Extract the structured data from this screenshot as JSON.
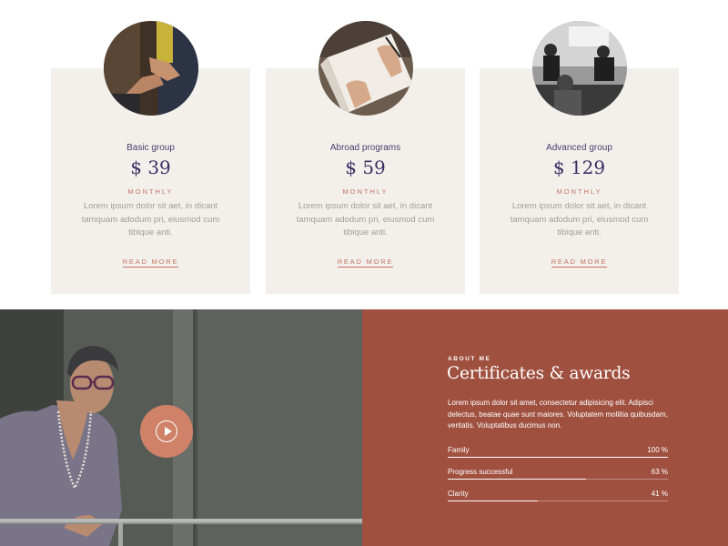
{
  "pricing": {
    "cards": [
      {
        "name": "Basic group",
        "price": "$ 39",
        "period": "MONTHLY",
        "text": "Lorem ipsum dolor sit aet, in dicant tamquam adodum pri, eiusmod cum tibique anti.",
        "link": "READ MORE"
      },
      {
        "name": "Abroad programs",
        "price": "$ 59",
        "period": "MONTHLY",
        "text": "Lorem ipsum dolor sit aet, in dicant tamquam adodum pri, eiusmod cum tibique anti.",
        "link": "READ MORE"
      },
      {
        "name": "Advanced group",
        "price": "$ 129",
        "period": "MONTHLY",
        "text": "Lorem ipsum dolor sit aet, in dicant tamquam adodum pri, eiusmod cum tibique anti.",
        "link": "READ MORE"
      }
    ]
  },
  "about": {
    "eyebrow": "ABOUT ME",
    "title": "Certificates & awards",
    "description": "Lorem ipsum dolor sit amet, consectetur adipisicing elit. Adipisci delectus, beatae quae sunt maiores. Voluptatem mollitia quibusdam, veritatis. Voluptatibus ducimus non.",
    "play_icon": "play-icon",
    "skills": [
      {
        "label": "Family",
        "percent_text": "100 %",
        "value": 100
      },
      {
        "label": "Progress successful",
        "percent_text": "63 %",
        "value": 63
      },
      {
        "label": "Clarity",
        "percent_text": "41 %",
        "value": 41
      }
    ]
  },
  "colors": {
    "accent": "#a0503f",
    "link": "#c4735f",
    "card_bg": "#f3f0ec",
    "price": "#3b2f63",
    "play_button": "#cf8268"
  }
}
